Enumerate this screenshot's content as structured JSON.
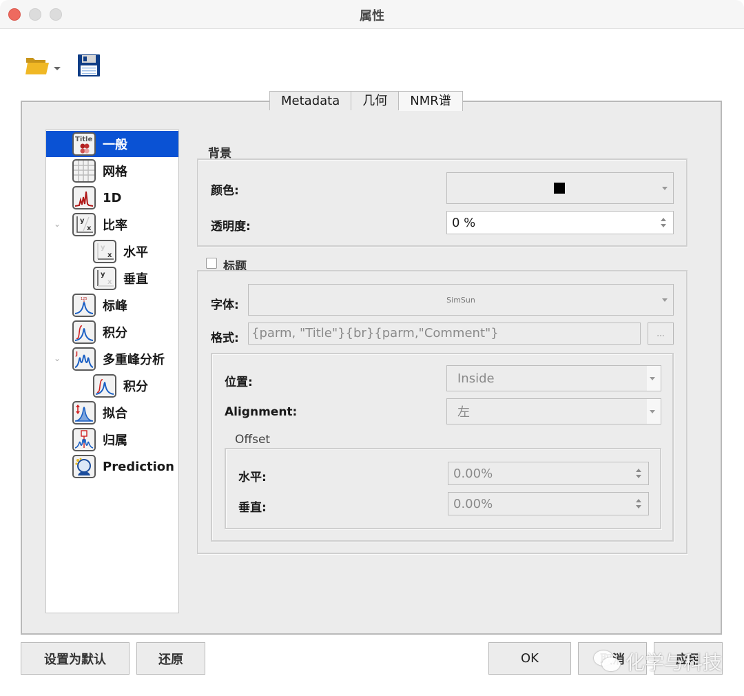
{
  "window": {
    "title": "属性"
  },
  "toolbar": {
    "open_icon": "folder-open-icon",
    "open_dropdown_icon": "caret-down-icon",
    "save_icon": "floppy-disk-icon"
  },
  "tabs": [
    {
      "label": "Metadata",
      "active": false
    },
    {
      "label": "几何",
      "active": false
    },
    {
      "label": "NMR谱",
      "active": true
    }
  ],
  "tree": {
    "items": [
      {
        "label": "一般",
        "icon": "title-icon",
        "level": 0,
        "selected": true
      },
      {
        "label": "网格",
        "icon": "grid-icon",
        "level": 0
      },
      {
        "label": "1D",
        "icon": "spectrum-1d-icon",
        "level": 0
      },
      {
        "label": "比率",
        "icon": "axes-xy-icon",
        "level": 0,
        "expanded": true
      },
      {
        "label": "水平",
        "icon": "axis-horizontal-icon",
        "level": 1
      },
      {
        "label": "垂直",
        "icon": "axis-vertical-icon",
        "level": 1
      },
      {
        "label": "标峰",
        "icon": "peak-label-icon",
        "level": 0
      },
      {
        "label": "积分",
        "icon": "integral-icon",
        "level": 0
      },
      {
        "label": "多重峰分析",
        "icon": "multiplet-icon",
        "level": 0,
        "expanded": true
      },
      {
        "label": "积分",
        "icon": "integral-icon",
        "level": 1
      },
      {
        "label": "拟合",
        "icon": "fitting-icon",
        "level": 0
      },
      {
        "label": "归属",
        "icon": "assignment-icon",
        "level": 0
      },
      {
        "label": "Prediction",
        "icon": "prediction-icon",
        "level": 0
      }
    ]
  },
  "background": {
    "group_title": "背景",
    "color_label": "颜色:",
    "color_value": "#000000",
    "transparency_label": "透明度:",
    "transparency_value": "0 %"
  },
  "title_section": {
    "group_title": "标题",
    "checked": false,
    "font_label": "字体:",
    "font_value": "SimSun",
    "format_label": "格式:",
    "format_value": "{parm, \"Title\"}{br}{parm,\"Comment\"}",
    "format_button": "...",
    "position_label": "位置:",
    "position_value": "Inside",
    "alignment_label": "Alignment:",
    "alignment_value": "左",
    "offset": {
      "group_title": "Offset",
      "horizontal_label": "水平:",
      "horizontal_value": "0.00%",
      "vertical_label": "垂直:",
      "vertical_value": "0.00%"
    }
  },
  "buttons": {
    "set_default": "设置为默认",
    "restore": "还原",
    "ok": "OK",
    "cancel": "取消",
    "apply": "应用"
  },
  "watermark": {
    "text": "化学与科技"
  },
  "colors": {
    "selection": "#0a52d4",
    "panel_bg": "#ececec",
    "close_button": "#ee6a5f"
  }
}
